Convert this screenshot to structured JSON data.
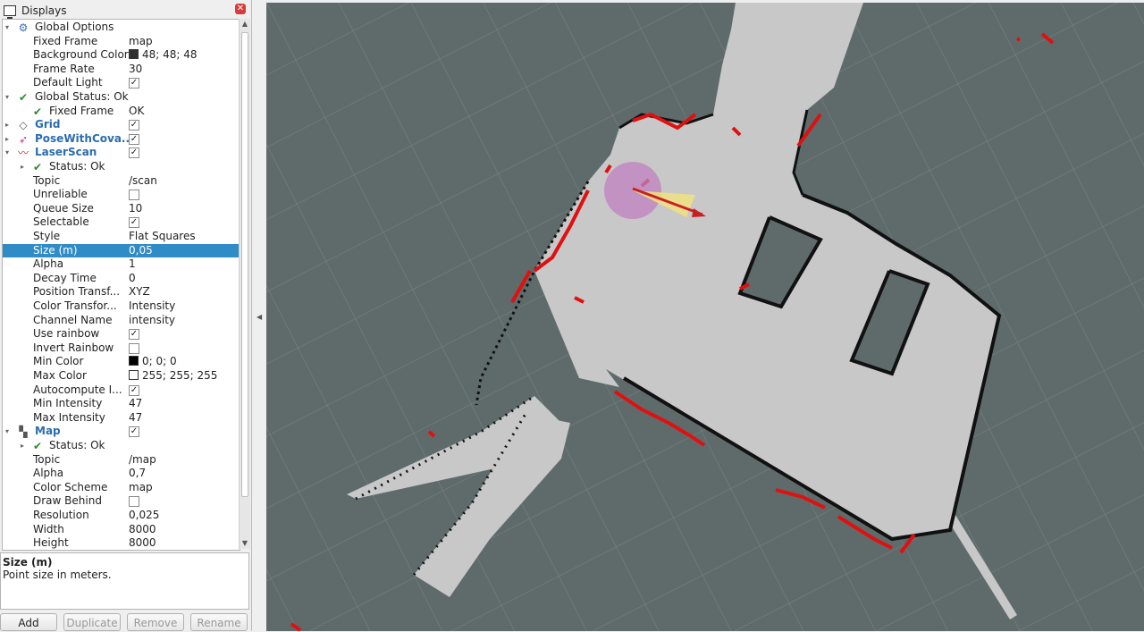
{
  "panel": {
    "title": "Displays",
    "tree": [
      {
        "indent": 0,
        "arrow": "expanded",
        "icon": "gear-icon",
        "label": "Global Options",
        "value": "",
        "kind": "group"
      },
      {
        "indent": 2,
        "label": "Fixed Frame",
        "value": "map",
        "kind": "text"
      },
      {
        "indent": 2,
        "label": "Background Color",
        "value": "48; 48; 48",
        "kind": "color",
        "swatch": "#303030"
      },
      {
        "indent": 2,
        "label": "Frame Rate",
        "value": "30",
        "kind": "text"
      },
      {
        "indent": 2,
        "label": "Default Light",
        "checked": true,
        "kind": "check"
      },
      {
        "indent": 0,
        "arrow": "expanded",
        "icon": "check-icon",
        "label": "Global Status: Ok",
        "value": "",
        "kind": "group"
      },
      {
        "indent": 1,
        "icon": "check-icon",
        "label": "Fixed Frame",
        "value": "OK",
        "kind": "text"
      },
      {
        "indent": 0,
        "arrow": "collapsed",
        "icon": "grid-icon",
        "label": "Grid",
        "checked": true,
        "kind": "display"
      },
      {
        "indent": 0,
        "arrow": "collapsed",
        "icon": "pose-icon",
        "label": "PoseWithCova...",
        "checked": true,
        "kind": "display"
      },
      {
        "indent": 0,
        "arrow": "expanded",
        "icon": "laser-icon",
        "label": "LaserScan",
        "checked": true,
        "kind": "display"
      },
      {
        "indent": 1,
        "arrow": "collapsed",
        "icon": "check-icon",
        "label": "Status: Ok",
        "value": "",
        "kind": "group"
      },
      {
        "indent": 2,
        "label": "Topic",
        "value": "/scan",
        "kind": "text"
      },
      {
        "indent": 2,
        "label": "Unreliable",
        "checked": false,
        "kind": "check"
      },
      {
        "indent": 2,
        "label": "Queue Size",
        "value": "10",
        "kind": "text"
      },
      {
        "indent": 2,
        "label": "Selectable",
        "checked": true,
        "kind": "check"
      },
      {
        "indent": 2,
        "label": "Style",
        "value": "Flat Squares",
        "kind": "text"
      },
      {
        "indent": 2,
        "label": "Size (m)",
        "value": "0,05",
        "kind": "text",
        "selected": true
      },
      {
        "indent": 2,
        "label": "Alpha",
        "value": "1",
        "kind": "text"
      },
      {
        "indent": 2,
        "label": "Decay Time",
        "value": "0",
        "kind": "text"
      },
      {
        "indent": 2,
        "label": "Position Transf...",
        "value": "XYZ",
        "kind": "text"
      },
      {
        "indent": 2,
        "label": "Color Transfor...",
        "value": "Intensity",
        "kind": "text"
      },
      {
        "indent": 2,
        "label": "Channel Name",
        "value": "intensity",
        "kind": "text"
      },
      {
        "indent": 2,
        "label": "Use rainbow",
        "checked": true,
        "kind": "check"
      },
      {
        "indent": 2,
        "label": "Invert Rainbow",
        "checked": false,
        "kind": "check"
      },
      {
        "indent": 2,
        "label": "Min Color",
        "value": "0; 0; 0",
        "kind": "color",
        "swatch": "#000000"
      },
      {
        "indent": 2,
        "label": "Max Color",
        "value": "255; 255; 255",
        "kind": "color",
        "swatch": "#ffffff"
      },
      {
        "indent": 2,
        "label": "Autocompute I...",
        "checked": true,
        "kind": "check"
      },
      {
        "indent": 2,
        "label": "Min Intensity",
        "value": "47",
        "kind": "text"
      },
      {
        "indent": 2,
        "label": "Max Intensity",
        "value": "47",
        "kind": "text"
      },
      {
        "indent": 0,
        "arrow": "expanded",
        "icon": "map-icon",
        "label": "Map",
        "checked": true,
        "kind": "display"
      },
      {
        "indent": 1,
        "arrow": "collapsed",
        "icon": "check-icon",
        "label": "Status: Ok",
        "value": "",
        "kind": "group"
      },
      {
        "indent": 2,
        "label": "Topic",
        "value": "/map",
        "kind": "text"
      },
      {
        "indent": 2,
        "label": "Alpha",
        "value": "0,7",
        "kind": "text"
      },
      {
        "indent": 2,
        "label": "Color Scheme",
        "value": "map",
        "kind": "text"
      },
      {
        "indent": 2,
        "label": "Draw Behind",
        "checked": false,
        "kind": "check"
      },
      {
        "indent": 2,
        "label": "Resolution",
        "value": "0,025",
        "kind": "text"
      },
      {
        "indent": 2,
        "label": "Width",
        "value": "8000",
        "kind": "text"
      },
      {
        "indent": 2,
        "label": "Height",
        "value": "8000",
        "kind": "text"
      }
    ],
    "description": {
      "title": "Size (m)",
      "text": "Point size in meters."
    },
    "buttons": [
      {
        "label": "Add",
        "enabled": true
      },
      {
        "label": "Duplicate",
        "enabled": false
      },
      {
        "label": "Remove",
        "enabled": false
      },
      {
        "label": "Rename",
        "enabled": false
      }
    ]
  },
  "viewport": {
    "background": "#5f6b6b",
    "map_free_color": "#c8c8c8",
    "map_wall_color": "#111111",
    "laser_color": "#e01010",
    "pose_color": "#c080c0"
  }
}
